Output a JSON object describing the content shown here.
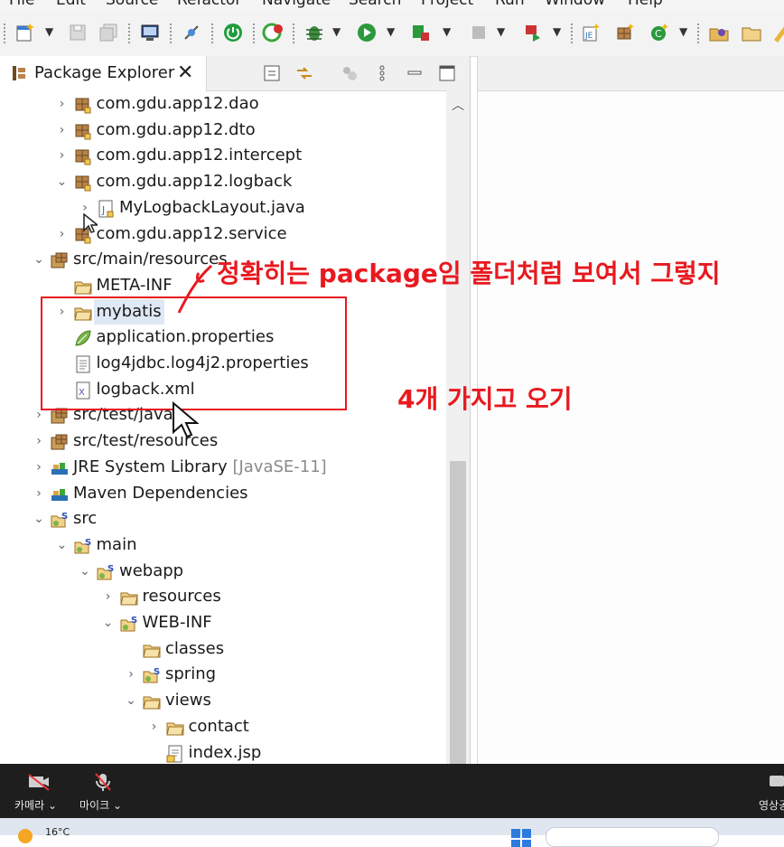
{
  "menu": [
    "File",
    "Edit",
    "Source",
    "Refactor",
    "Navigate",
    "Search",
    "Project",
    "Run",
    "Window",
    "Help"
  ],
  "view": {
    "title": "Package Explorer",
    "close": "✕"
  },
  "tree": [
    {
      "label": "com.gdu.app12.dao",
      "arrow": "›",
      "icon": "package"
    },
    {
      "label": "com.gdu.app12.dto",
      "arrow": "›",
      "icon": "package"
    },
    {
      "label": "com.gdu.app12.intercept",
      "arrow": "›",
      "icon": "package"
    },
    {
      "label": "com.gdu.app12.logback",
      "arrow": "⌄",
      "icon": "package"
    },
    {
      "label": "MyLogbackLayout.java",
      "arrow": "›",
      "icon": "java-file"
    },
    {
      "label": "com.gdu.app12.service",
      "arrow": "›",
      "icon": "package"
    },
    {
      "label": "src/main/resources",
      "arrow": "⌄",
      "icon": "source-folder"
    },
    {
      "label": "META-INF",
      "arrow": "",
      "icon": "folder"
    },
    {
      "label": "mybatis",
      "arrow": "›",
      "icon": "folder"
    },
    {
      "label": "application.properties",
      "arrow": "",
      "icon": "spring-properties"
    },
    {
      "label": "log4jdbc.log4j2.properties",
      "arrow": "",
      "icon": "properties-file"
    },
    {
      "label": "logback.xml",
      "arrow": "",
      "icon": "xml-file"
    },
    {
      "label": "src/test/java",
      "arrow": "›",
      "icon": "source-folder"
    },
    {
      "label": "src/test/resources",
      "arrow": "›",
      "icon": "source-folder"
    },
    {
      "label": "JRE System Library",
      "decoration": "[JavaSE-11]",
      "arrow": "›",
      "icon": "library"
    },
    {
      "label": "Maven Dependencies",
      "arrow": "›",
      "icon": "library"
    },
    {
      "label": "src",
      "arrow": "⌄",
      "icon": "spring-folder"
    },
    {
      "label": "main",
      "arrow": "⌄",
      "icon": "spring-folder"
    },
    {
      "label": "webapp",
      "arrow": "⌄",
      "icon": "spring-folder"
    },
    {
      "label": "resources",
      "arrow": "›",
      "icon": "folder"
    },
    {
      "label": "WEB-INF",
      "arrow": "⌄",
      "icon": "spring-folder"
    },
    {
      "label": "classes",
      "arrow": "",
      "icon": "folder"
    },
    {
      "label": "spring",
      "arrow": "›",
      "icon": "spring-folder"
    },
    {
      "label": "views",
      "arrow": "⌄",
      "icon": "folder"
    },
    {
      "label": "contact",
      "arrow": "›",
      "icon": "folder"
    },
    {
      "label": "index.jsp",
      "arrow": "",
      "icon": "jsp-file"
    }
  ],
  "annotations": {
    "note1": "정확히는 package임 폴더처럼 보여서 그렇지",
    "note2": "4개 가지고 오기"
  },
  "zoom": {
    "camera": "카메라",
    "mic": "마이크",
    "share": "영상공"
  },
  "taskbar": {
    "weather": "16°C"
  },
  "colors": {
    "annotation": "#e8191f",
    "accent": "#2c6fb3"
  }
}
